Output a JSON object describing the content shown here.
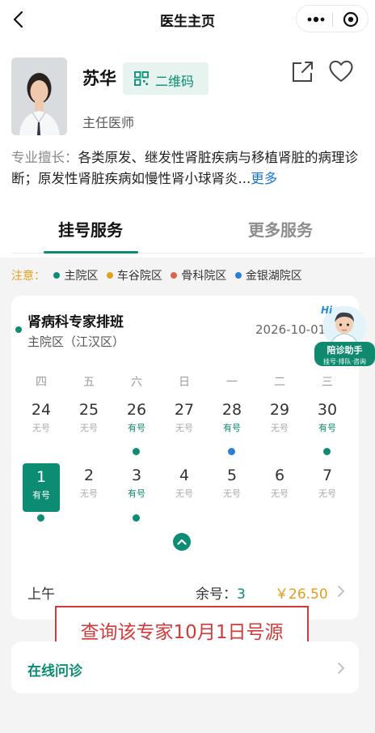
{
  "nav": {
    "title": "医生主页",
    "back_icon": "chevron-left-icon",
    "more_icon": "more-dots-icon",
    "close_icon": "target-close-icon"
  },
  "doctor": {
    "name": "苏华",
    "qr_label": "二维码",
    "title": "主任医师",
    "specialty_label": "专业擅长：",
    "specialty_text": "各类原发、继发性肾脏疾病与移植肾脏的病理诊断；原发性肾脏疾病如慢性肾小球肾炎...",
    "more_link": "更多"
  },
  "tabs": [
    {
      "label": "挂号服务",
      "active": true
    },
    {
      "label": "更多服务",
      "active": false
    }
  ],
  "legend": {
    "note": "注意：",
    "items": [
      {
        "label": "主院区",
        "color": "#0b8c73"
      },
      {
        "label": "车谷院区",
        "color": "#e0a21c"
      },
      {
        "label": "骨科院区",
        "color": "#d9644a"
      },
      {
        "label": "金银湖院区",
        "color": "#2b7fd0"
      }
    ]
  },
  "schedule": {
    "title": "肾病科专家排班",
    "campus": "主院区（江汉区）",
    "date": "2026-10-01",
    "weekdays": [
      "四",
      "五",
      "六",
      "日",
      "一",
      "二",
      "三"
    ],
    "week1": [
      {
        "day": "24",
        "status": "无号",
        "has": false,
        "dot": null
      },
      {
        "day": "25",
        "status": "无号",
        "has": false,
        "dot": null
      },
      {
        "day": "26",
        "status": "有号",
        "has": true,
        "dot": "#0b8c73"
      },
      {
        "day": "27",
        "status": "无号",
        "has": false,
        "dot": null
      },
      {
        "day": "28",
        "status": "有号",
        "has": true,
        "dot": "#2b7fd0"
      },
      {
        "day": "29",
        "status": "无号",
        "has": false,
        "dot": null
      },
      {
        "day": "30",
        "status": "有号",
        "has": true,
        "dot": "#0b8c73"
      }
    ],
    "week2": [
      {
        "day": "1",
        "status": "有号",
        "has": true,
        "dot": "#0b8c73",
        "selected": true
      },
      {
        "day": "2",
        "status": "无号",
        "has": false,
        "dot": null
      },
      {
        "day": "3",
        "status": "有号",
        "has": true,
        "dot": "#0b8c73"
      },
      {
        "day": "4",
        "status": "无号",
        "has": false,
        "dot": null
      },
      {
        "day": "5",
        "status": "无号",
        "has": false,
        "dot": null
      },
      {
        "day": "6",
        "status": "无号",
        "has": false,
        "dot": null
      },
      {
        "day": "7",
        "status": "无号",
        "has": false,
        "dot": null
      }
    ],
    "slot": {
      "period": "上午",
      "remain_label": "余号：",
      "remain": "3",
      "price": "￥26.50"
    }
  },
  "assistant": {
    "hi": "Hi",
    "label": "陪诊助手",
    "sub": "挂号·排队·咨询"
  },
  "annotation": "查询该专家10月1日号源",
  "consult": {
    "label": "在线问诊"
  }
}
